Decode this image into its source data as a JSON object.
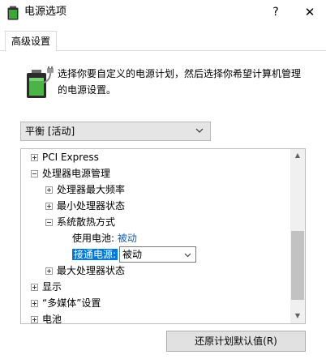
{
  "window": {
    "title": "电源选项",
    "help_label": "?",
    "close_label": "✕"
  },
  "tab": {
    "label": "高级设置"
  },
  "description": {
    "line1": "选择你要自定义的电源计划，然后选择你希望计算机管理",
    "line2": "的电源设置。"
  },
  "plan_select": {
    "value": "平衡 [活动]"
  },
  "tree": {
    "items": [
      {
        "label": "PCI Express",
        "expander": "+"
      },
      {
        "label": "处理器电源管理",
        "expander": "-"
      },
      {
        "label": "处理器最大频率",
        "expander": "+"
      },
      {
        "label": "最小处理器状态",
        "expander": "+"
      },
      {
        "label": "系统散热方式",
        "expander": "-"
      },
      {
        "label": "最大处理器状态",
        "expander": "+"
      },
      {
        "label": "显示",
        "expander": "+"
      },
      {
        "label": "“多媒体”设置",
        "expander": "+"
      },
      {
        "label": "电池",
        "expander": "+"
      }
    ],
    "battery_setting": {
      "label": "使用电池:",
      "value": "被动"
    },
    "plugged_setting": {
      "label": "接通电源:",
      "value": "被动"
    }
  },
  "buttons": {
    "restore_defaults": "还原计划默认值(R)"
  },
  "icons": {
    "app": "battery-icon",
    "plan_chevron": "chevron-down-icon",
    "scroll_up": "scroll-up-icon",
    "scroll_down": "scroll-down-icon"
  }
}
